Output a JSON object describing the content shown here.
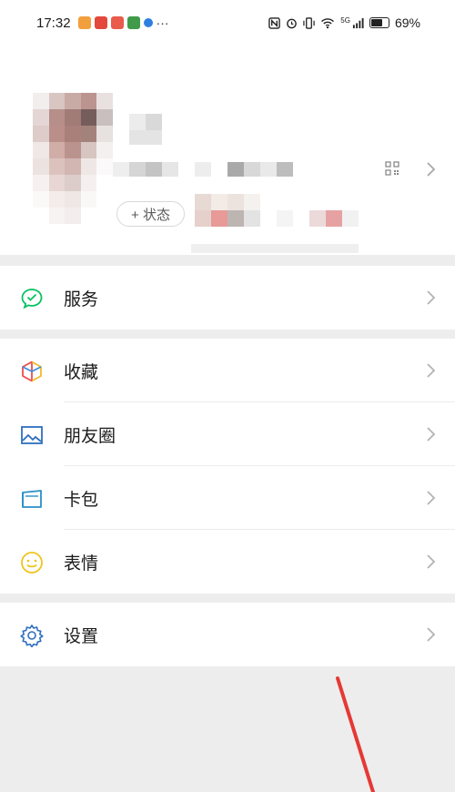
{
  "status_bar": {
    "time": "17:32",
    "battery": "69%",
    "battery_level": 0.69,
    "signal": "5G"
  },
  "profile": {
    "status_button": "+ 状态"
  },
  "menu": {
    "service": {
      "label": "服务",
      "icon": "wechat-pay-icon"
    },
    "favorites": {
      "label": "收藏",
      "icon": "cube-icon"
    },
    "moments": {
      "label": "朋友圈",
      "icon": "picture-icon"
    },
    "cards": {
      "label": "卡包",
      "icon": "card-wallet-icon"
    },
    "stickers": {
      "label": "表情",
      "icon": "smiley-icon"
    },
    "settings": {
      "label": "设置",
      "icon": "gear-icon"
    }
  },
  "colors": {
    "background": "#ededed",
    "service_green": "#07c160",
    "annotation_red": "#e53935"
  }
}
